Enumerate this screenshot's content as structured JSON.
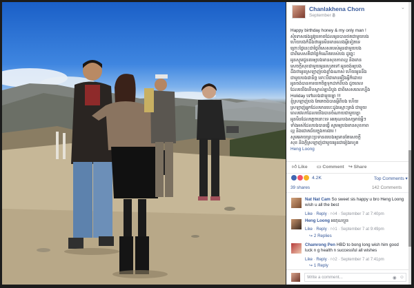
{
  "post": {
    "author": "Chanlakhena Chorn",
    "date": "September 7",
    "lines": [
      "Happy birthday honey & my only man !",
      "សុំទោសផងនូវរូបភាពដែលអូនបានថតជាមួយបង",
      "ហើយបងក៏ដឹងថាអូនមិនមានលេងអ្វីទៀតទេ",
      "ព្រោះថ្ងៃនេះជាថ្ងៃពិសេសរបស់អូនជាមួយបង",
      "ជាពិសេសគឺជាថ្ងៃកំណើតរបស់បង ដូច្នេះ",
      "អូនសូមជូនពរឲ្យបងមានសុខភាពល្អ និងមាន",
      "សេចក្តីសុខជាមួយអូនរហូតទៅ អូនចង់ឲ្យបង",
      "ដឹងថាអូនស្រឡាញ់បងខ្លាំងណាស់ ហើយអូននឹង",
      "ជាមួយបងជានិច្ច ទោះបីជាមានរឿងអ្វីក៏ដោយ",
      "អូនចង់បានការយកចិត្តទុកដាក់ពីបង ដូចពេល",
      "ដែលយើងទើបស្គាល់គ្នាដំបូង ជាពិសេសពេលហ្នឹង",
      "Holiday ទៅលេងជាមួយគ្នា !!!",
      "ខ្ញុំស្រឡាញ់បង តែគេចង់បានអ្វីពីបង ហើយ",
      "ស្រឡាញ់អ្នកដែលមានបេះដូងស្មោះត្រង់ ជាមួយ",
      "ពេលវេលាដែលយើងបានចំណាយជាមួយគ្នា",
      "អូនមិនដែលភ្លេចនោះទេ អរគុណបងសម្រាប់អ្វីៗ",
      "ទាំងអស់ដែលបងបានធ្វើ សូមឲ្យបងមានសុខភាព",
      "ល្អ និងជោគជ័យក្នុងការងារ !",
      "សូមអោយព្រះប្រទានពរបងឲ្យមានតែសេចក្តី",
      "សុខ និងក្តីស្រឡាញ់ជាមួយអូនជារៀងរហូត"
    ],
    "tag": "Heng Loong"
  },
  "actions": {
    "like": "Like",
    "comment": "Comment",
    "share": "Share"
  },
  "stats": {
    "reactions": "4.2K",
    "top_comments": "Top Comments ▾",
    "shares": "39 shares",
    "comments": "142 Comments"
  },
  "comments": [
    {
      "name": "Nat Nat Cam",
      "text": "So sweet sis happy u bro Heng Loong wish u all the best",
      "like": "Like",
      "reply": "Reply",
      "likes": "4",
      "time": "September 7 at 7:40pm",
      "replies": ""
    },
    {
      "name": "Heng Loong",
      "text": "អរគុណប្អូន",
      "like": "Like",
      "reply": "Reply",
      "likes": "1",
      "time": "September 7 at 9:49pm",
      "replies": "2 Replies"
    },
    {
      "name": "Chamrong Pen",
      "text": "HBD to bong long wish him good luck n g health n successful all wishes",
      "like": "Like",
      "reply": "Reply",
      "likes": "2",
      "time": "September 7 at 7:41pm",
      "replies": "1 Reply"
    }
  ],
  "composer": {
    "placeholder": "Write a comment..."
  },
  "colors": {
    "link": "#365899",
    "meta": "#90949c",
    "like_blue": "#4267b2",
    "love_red": "#f25268"
  },
  "icons": [
    "globe-icon",
    "chevron-down-icon",
    "like-icon",
    "comment-icon",
    "share-icon",
    "camera-icon",
    "sticker-icon"
  ]
}
